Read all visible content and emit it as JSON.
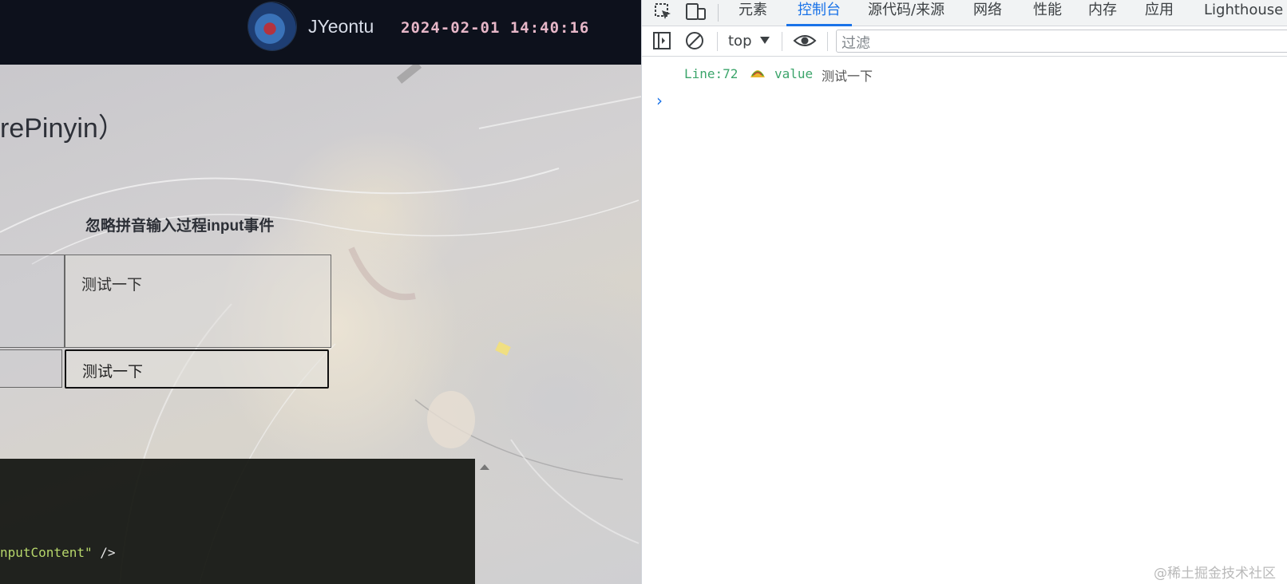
{
  "header": {
    "username": "JYeontu",
    "datetime": "2024-02-01 14:40:16"
  },
  "main": {
    "title_fragment": "rePinyin）",
    "demo_heading": "忽略拼音输入过程input事件",
    "textarea_value": "测试一下",
    "input_value": "测试一下",
    "code_snippet": {
      "text": "nputContent\"",
      "tail": " />"
    }
  },
  "devtools": {
    "tabs": [
      {
        "label": "元素"
      },
      {
        "label": "控制台",
        "active": true
      },
      {
        "label": "源代码/来源"
      },
      {
        "label": "网络"
      },
      {
        "label": "性能"
      },
      {
        "label": "内存"
      },
      {
        "label": "应用"
      },
      {
        "label": "Lighthouse"
      }
    ],
    "toolbar": {
      "context": "top",
      "filter_placeholder": "过滤"
    },
    "console": {
      "source": "Line:72",
      "emoji": "taco",
      "key": "value",
      "value": "测试一下"
    }
  },
  "watermark": "@稀土掘金技术社区",
  "icons": [
    "inspect-element-icon",
    "device-toolbar-icon",
    "sidebar-toggle-icon",
    "clear-console-icon",
    "eye-icon",
    "taco-emoji-icon",
    "prompt-caret-icon",
    "chevron-up-icon"
  ],
  "colors": {
    "header_bg": "#0d111c",
    "devtools_accent": "#1a73e8",
    "console_green": "#3ca56b"
  }
}
